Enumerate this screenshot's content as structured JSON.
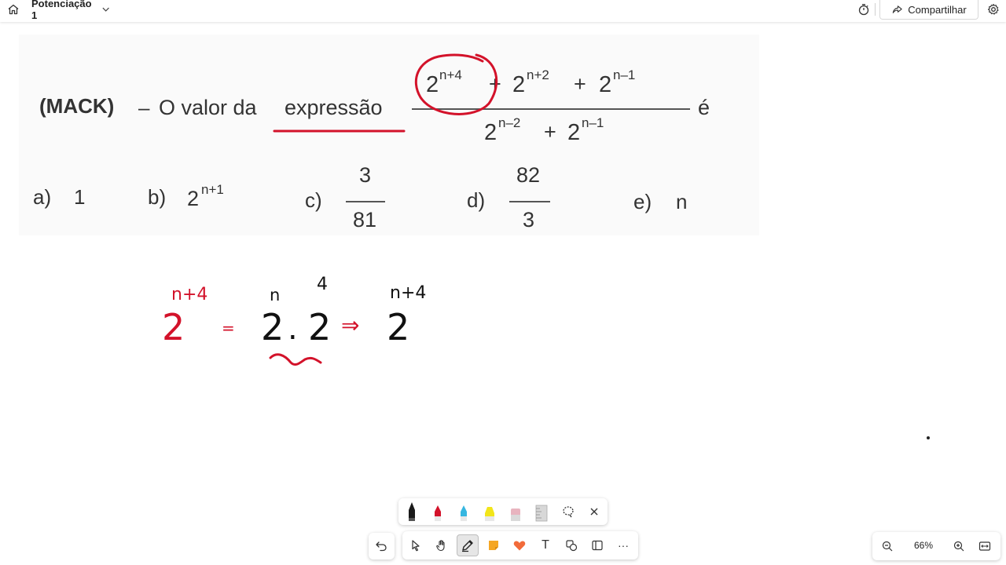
{
  "app": {
    "title": "Potenciação 1",
    "share_label": "Compartilhar"
  },
  "icons": {
    "home": "home-icon",
    "chevron": "chevron-down-icon",
    "timer": "timer-icon",
    "share": "share-icon",
    "settings": "settings-gear-icon"
  },
  "problem": {
    "source": "(MACK)",
    "dash": "–",
    "prompt_pre": "O valor da",
    "prompt_word": "expressão",
    "numerator": {
      "t1_base": "2",
      "t1_exp": "n+4",
      "plus1": "+",
      "t2_base": "2",
      "t2_exp": "n+2",
      "plus2": "+",
      "t3_base": "2",
      "t3_exp": "n–1"
    },
    "denominator": {
      "t1_base": "2",
      "t1_exp": "n–2",
      "plus": "+",
      "t2_base": "2",
      "t2_exp": "n–1"
    },
    "suffix": "é",
    "options": {
      "a_label": "a)",
      "a_value": "1",
      "b_label": "b)",
      "b_base": "2",
      "b_exp": "n+1",
      "c_label": "c)",
      "c_num": "3",
      "c_den": "81",
      "d_label": "d)",
      "d_num": "82",
      "d_den": "3",
      "e_label": "e)",
      "e_value": "n"
    }
  },
  "handwriting": {
    "lhs_base": "2",
    "lhs_exp": "n+4",
    "eq": "=",
    "mid_base1": "2",
    "mid_exp1": "n",
    "dot": ".",
    "mid_base2": "2",
    "mid_exp2": "4",
    "implies": "⇒",
    "rhs_base": "2",
    "rhs_exp": "n+4"
  },
  "colors": {
    "ink_red": "#d3122a",
    "ink_black": "#111111",
    "highlighter_yellow": "#f2e51a",
    "pen_cyan": "#36b6e0",
    "sticky_orange": "#f5a623",
    "reaction_heart": "#f26b3a"
  },
  "pen_tray": {
    "items": [
      "black-pen",
      "red-pen",
      "blue-pen",
      "yellow-highlighter",
      "eraser",
      "ruler",
      "lasso-select",
      "close"
    ]
  },
  "main_toolbar": {
    "items": [
      "undo",
      "select",
      "pan",
      "ink",
      "sticky-note",
      "reaction",
      "text",
      "shapes",
      "templates",
      "more"
    ],
    "more_label": "···",
    "text_label": "T"
  },
  "zoom": {
    "level": "66%"
  }
}
